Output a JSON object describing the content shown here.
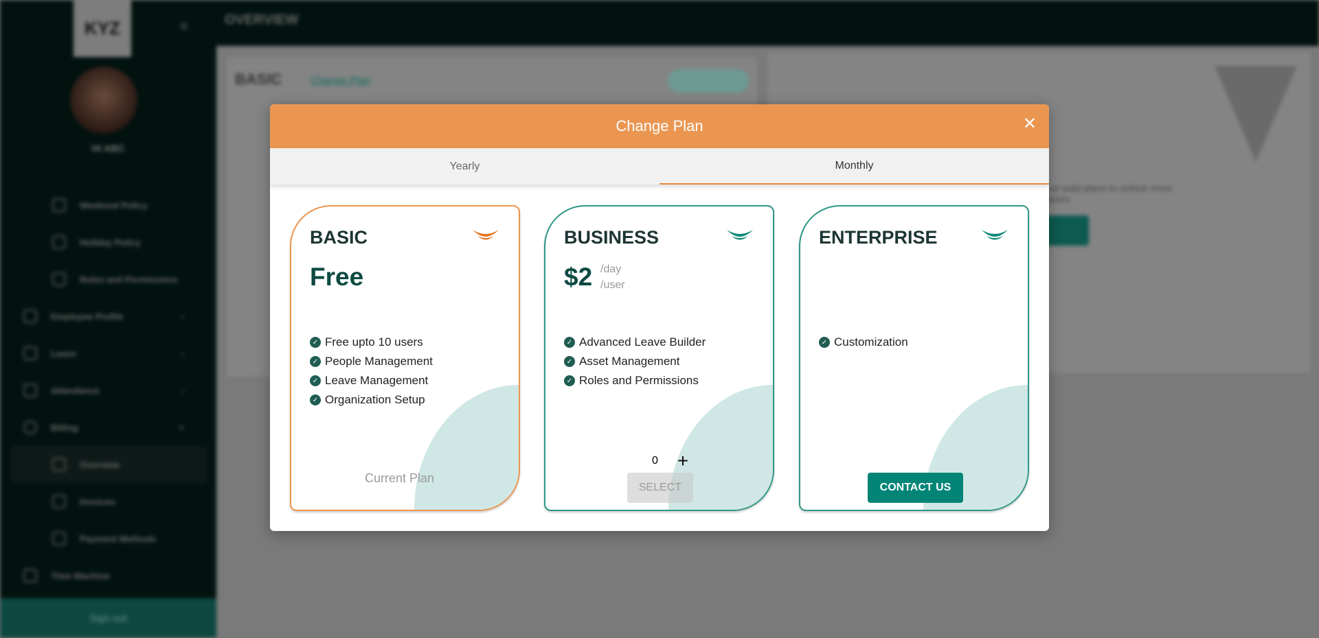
{
  "background": {
    "logo": "KYZ",
    "greeting": "Hi ABC",
    "page_title": "OVERVIEW",
    "nav": [
      {
        "label": "Weekend Policy"
      },
      {
        "label": "Holiday Policy"
      },
      {
        "label": "Roles and Permissions"
      },
      {
        "label": "Employee Profile"
      },
      {
        "label": "Leave"
      },
      {
        "label": "Attendance"
      },
      {
        "label": "Billing"
      },
      {
        "label": "Overview"
      },
      {
        "label": "Invoices"
      },
      {
        "label": "Payment Methods"
      },
      {
        "label": "Time Machine"
      }
    ],
    "sign_out": "Sign out",
    "plan_name": "BASIC",
    "change_plan_link": "Change Plan",
    "upgrade_text": "to our paid plans to unlock more features"
  },
  "modal": {
    "title": "Change Plan",
    "close_icon": "close-icon",
    "tabs": [
      {
        "label": "Yearly"
      },
      {
        "label": "Monthly",
        "active": true
      }
    ],
    "plans": [
      {
        "name": "BASIC",
        "price": "Free",
        "features": [
          "Free upto 10 users",
          "People Management",
          "Leave Management",
          "Organization Setup"
        ],
        "status": "Current Plan",
        "accent": "#ea8a3e"
      },
      {
        "name": "BUSINESS",
        "price": "$2",
        "unit_day": "/day",
        "unit_user": "/user",
        "features": [
          "Advanced Leave Builder",
          "Asset Management",
          "Roles and Permissions"
        ],
        "quantity": "0",
        "add_icon": "plus-icon",
        "action": "SELECT",
        "accent": "#2e9686"
      },
      {
        "name": "ENTERPRISE",
        "features": [
          "Customization"
        ],
        "action": "CONTACT US",
        "accent": "#2e9686"
      }
    ]
  },
  "colors": {
    "header": "#ea9651",
    "primary": "#028577",
    "sidebar": "#02120f"
  }
}
